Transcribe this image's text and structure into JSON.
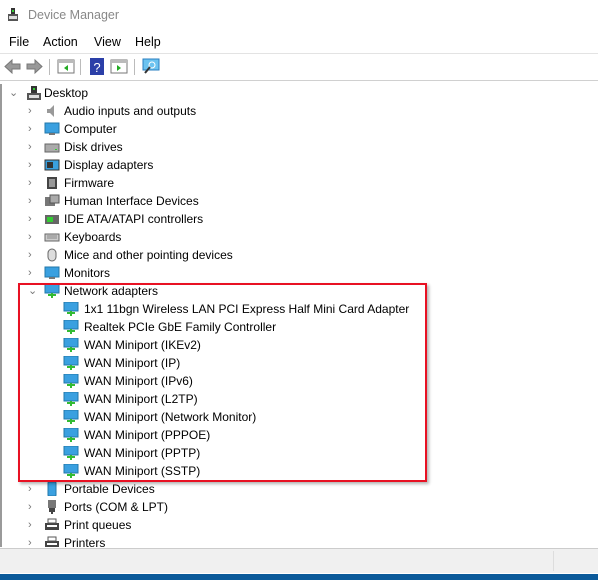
{
  "window": {
    "title": "Device Manager"
  },
  "menu": [
    "File",
    "Action",
    "View",
    "Help"
  ],
  "toolbar": {
    "icons": [
      "back-arrow-icon",
      "forward-arrow-icon",
      "show-hide-console-tree-icon",
      "help-icon",
      "properties-pane-icon",
      "scan-hardware-icon"
    ]
  },
  "tree": {
    "root": "Desktop",
    "categories": [
      {
        "label": "Audio inputs and outputs",
        "icon": "speaker-icon"
      },
      {
        "label": "Computer",
        "icon": "monitor-icon"
      },
      {
        "label": "Disk drives",
        "icon": "disk-icon"
      },
      {
        "label": "Display adapters",
        "icon": "display-adapter-icon"
      },
      {
        "label": "Firmware",
        "icon": "chip-icon"
      },
      {
        "label": "Human Interface Devices",
        "icon": "hid-icon"
      },
      {
        "label": "IDE ATA/ATAPI controllers",
        "icon": "ide-icon"
      },
      {
        "label": "Keyboards",
        "icon": "keyboard-icon"
      },
      {
        "label": "Mice and other pointing devices",
        "icon": "mouse-icon"
      },
      {
        "label": "Monitors",
        "icon": "monitor-icon"
      },
      {
        "label": "Network adapters",
        "icon": "network-icon",
        "expanded": true,
        "children": [
          "1x1 11bgn Wireless LAN PCI Express Half Mini Card Adapter",
          "Realtek PCIe GbE Family Controller",
          "WAN Miniport (IKEv2)",
          "WAN Miniport (IP)",
          "WAN Miniport (IPv6)",
          "WAN Miniport (L2TP)",
          "WAN Miniport (Network Monitor)",
          "WAN Miniport (PPPOE)",
          "WAN Miniport (PPTP)",
          "WAN Miniport (SSTP)"
        ]
      },
      {
        "label": "Portable Devices",
        "icon": "portable-device-icon"
      },
      {
        "label": "Ports (COM & LPT)",
        "icon": "port-icon"
      },
      {
        "label": "Print queues",
        "icon": "printer-icon"
      },
      {
        "label": "Printers",
        "icon": "printer-icon"
      }
    ]
  },
  "colors": {
    "highlight": "#e81123",
    "taskbar": "#0b5a9a"
  }
}
